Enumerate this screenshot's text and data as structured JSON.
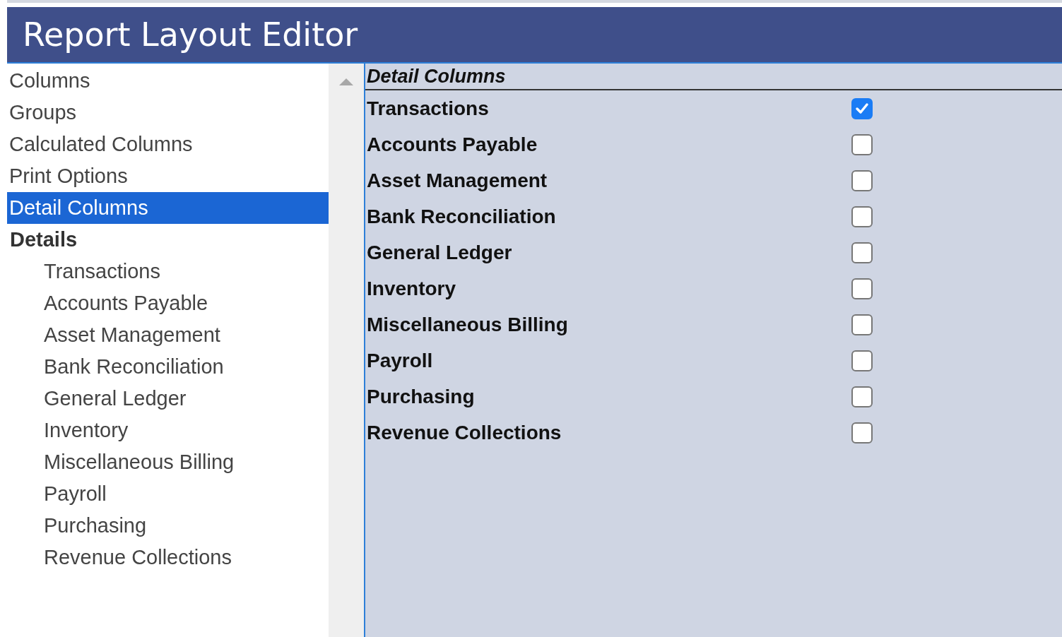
{
  "window": {
    "title": "Report Layout Editor"
  },
  "sidebar": {
    "items": [
      {
        "label": "Columns",
        "selected": false
      },
      {
        "label": "Groups",
        "selected": false
      },
      {
        "label": "Calculated Columns",
        "selected": false
      },
      {
        "label": "Print Options",
        "selected": false
      },
      {
        "label": "Detail Columns",
        "selected": true
      }
    ],
    "tree": {
      "label": "Details",
      "children": [
        {
          "label": "Transactions"
        },
        {
          "label": "Accounts Payable"
        },
        {
          "label": "Asset Management"
        },
        {
          "label": "Bank Reconciliation"
        },
        {
          "label": "General Ledger"
        },
        {
          "label": "Inventory"
        },
        {
          "label": "Miscellaneous Billing"
        },
        {
          "label": "Payroll"
        },
        {
          "label": "Purchasing"
        },
        {
          "label": "Revenue Collections"
        }
      ]
    }
  },
  "panel": {
    "heading": "Detail Columns",
    "rows": [
      {
        "label": "Transactions",
        "checked": true
      },
      {
        "label": "Accounts Payable",
        "checked": false
      },
      {
        "label": "Asset Management",
        "checked": false
      },
      {
        "label": "Bank Reconciliation",
        "checked": false
      },
      {
        "label": "General Ledger",
        "checked": false
      },
      {
        "label": "Inventory",
        "checked": false
      },
      {
        "label": "Miscellaneous Billing",
        "checked": false
      },
      {
        "label": "Payroll",
        "checked": false
      },
      {
        "label": "Purchasing",
        "checked": false
      },
      {
        "label": "Revenue Collections",
        "checked": false
      }
    ]
  }
}
